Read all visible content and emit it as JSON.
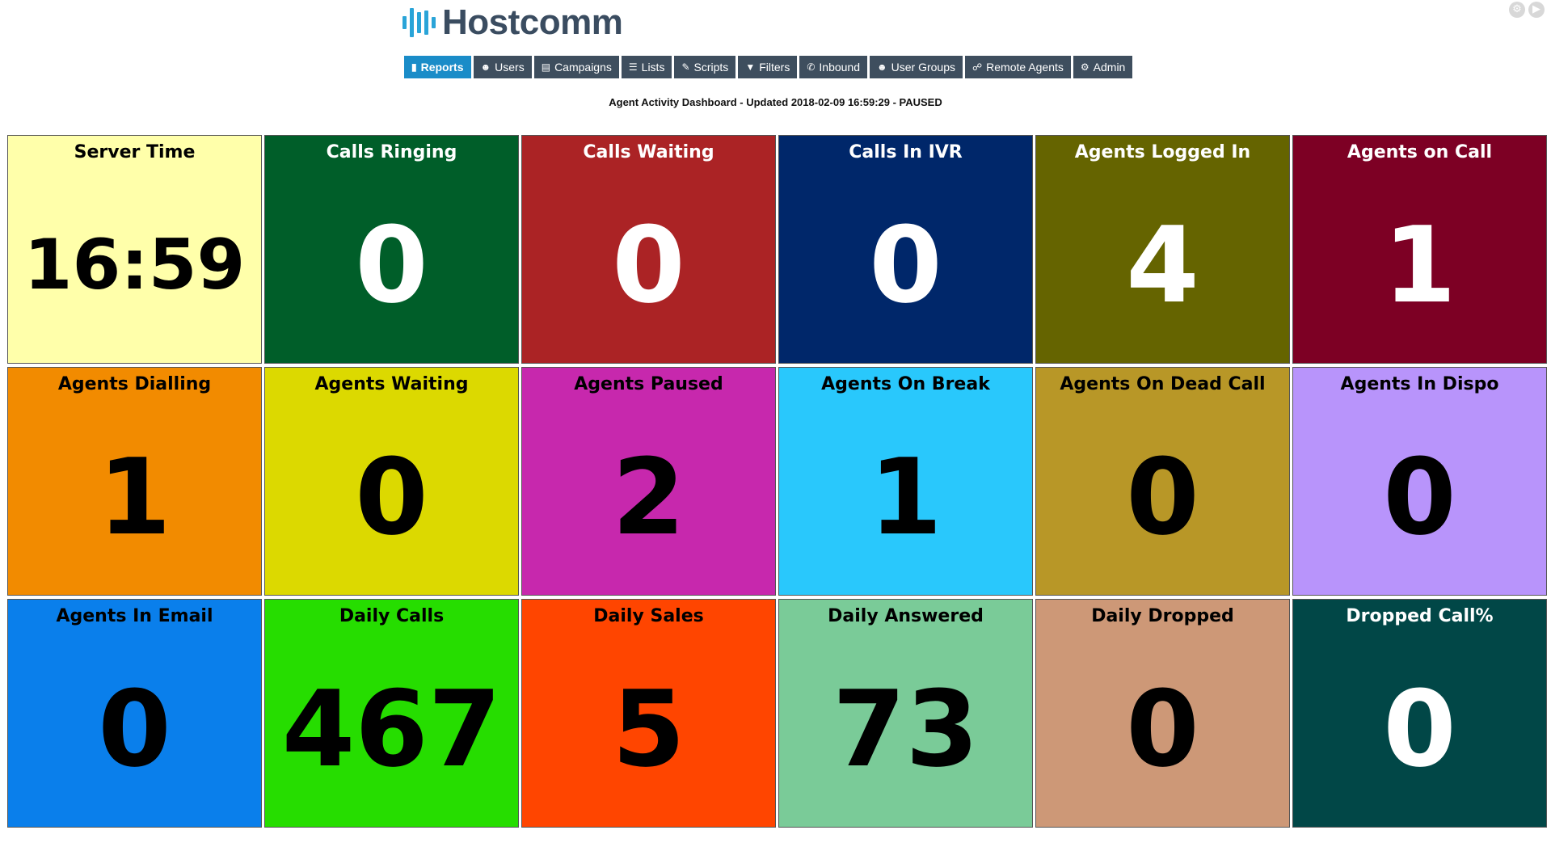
{
  "brand": {
    "name": "Hostcomm",
    "accent": "#2aa4d8"
  },
  "top_icons": [
    "gear-icon",
    "play-icon"
  ],
  "nav": [
    {
      "label": "Reports",
      "icon": "chart-icon",
      "active": true
    },
    {
      "label": "Users",
      "icon": "users-icon",
      "active": false
    },
    {
      "label": "Campaigns",
      "icon": "campaigns-icon",
      "active": false
    },
    {
      "label": "Lists",
      "icon": "list-icon",
      "active": false
    },
    {
      "label": "Scripts",
      "icon": "edit-icon",
      "active": false
    },
    {
      "label": "Filters",
      "icon": "filter-icon",
      "active": false
    },
    {
      "label": "Inbound",
      "icon": "phone-icon",
      "active": false
    },
    {
      "label": "User Groups",
      "icon": "user-groups-icon",
      "active": false
    },
    {
      "label": "Remote Agents",
      "icon": "remote-agents-icon",
      "active": false
    },
    {
      "label": "Admin",
      "icon": "cog-icon",
      "active": false
    }
  ],
  "dashboard": {
    "subtitle": "Agent Activity Dashboard - Updated 2018-02-09 16:59:29 - PAUSED"
  },
  "tiles": [
    {
      "label": "Server Time",
      "value": "16:59",
      "bg": "#ffffaa",
      "text": "dark"
    },
    {
      "label": "Calls Ringing",
      "value": "0",
      "bg": "#005e29",
      "text": "light"
    },
    {
      "label": "Calls Waiting",
      "value": "0",
      "bg": "#ab2325",
      "text": "light"
    },
    {
      "label": "Calls In IVR",
      "value": "0",
      "bg": "#00276a",
      "text": "light"
    },
    {
      "label": "Agents Logged In",
      "value": "4",
      "bg": "#656400",
      "text": "light"
    },
    {
      "label": "Agents on Call",
      "value": "1",
      "bg": "#7d0024",
      "text": "light"
    },
    {
      "label": "Agents Dialling",
      "value": "1",
      "bg": "#f28b00",
      "text": "dark"
    },
    {
      "label": "Agents Waiting",
      "value": "0",
      "bg": "#dcd900",
      "text": "dark"
    },
    {
      "label": "Agents Paused",
      "value": "2",
      "bg": "#c728ad",
      "text": "dark"
    },
    {
      "label": "Agents On Break",
      "value": "1",
      "bg": "#29c8fc",
      "text": "dark"
    },
    {
      "label": "Agents On Dead Call",
      "value": "0",
      "bg": "#b89727",
      "text": "dark"
    },
    {
      "label": "Agents In Dispo",
      "value": "0",
      "bg": "#b894fb",
      "text": "dark"
    },
    {
      "label": "Agents In Email",
      "value": "0",
      "bg": "#0a7feb",
      "text": "dark"
    },
    {
      "label": "Daily Calls",
      "value": "467",
      "bg": "#26dd00",
      "text": "dark"
    },
    {
      "label": "Daily Sales",
      "value": "5",
      "bg": "#ff4500",
      "text": "dark"
    },
    {
      "label": "Daily Answered",
      "value": "73",
      "bg": "#7acb98",
      "text": "dark"
    },
    {
      "label": "Daily Dropped",
      "value": "0",
      "bg": "#cd9877",
      "text": "dark"
    },
    {
      "label": "Dropped Call%",
      "value": "0",
      "bg": "#014747",
      "text": "light"
    }
  ]
}
